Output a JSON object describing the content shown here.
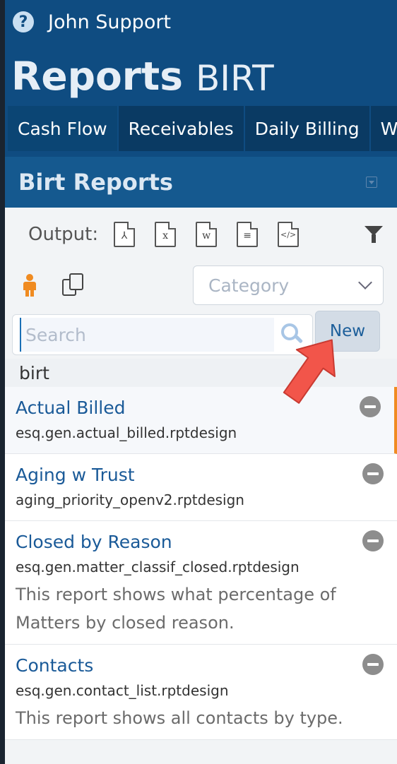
{
  "header": {
    "user_name": "John Support",
    "help_icon": "question-circle-icon"
  },
  "page": {
    "title": "Reports",
    "subtitle": "BIRT"
  },
  "tabs": [
    {
      "label": "Cash Flow",
      "active": true
    },
    {
      "label": "Receivables",
      "active": false
    },
    {
      "label": "Daily Billing",
      "active": false
    },
    {
      "label": "W",
      "active": false
    }
  ],
  "panel": {
    "title": "Birt Reports",
    "output_label": "Output:",
    "output_formats": [
      {
        "icon": "pdf-file-icon",
        "glyph": "⅄"
      },
      {
        "icon": "excel-file-icon",
        "glyph": "x"
      },
      {
        "icon": "word-file-icon",
        "glyph": "w"
      },
      {
        "icon": "text-file-icon",
        "glyph": "≡"
      },
      {
        "icon": "html-file-icon",
        "glyph": "</>"
      }
    ],
    "category_placeholder": "Category",
    "search_placeholder": "Search",
    "new_label": "New",
    "group_label": "birt"
  },
  "reports": [
    {
      "name": "Actual Billed",
      "file": "esq.gen.actual_billed.rptdesign",
      "description": "",
      "active": true
    },
    {
      "name": "Aging w Trust",
      "file": "aging_priority_openv2.rptdesign",
      "description": "",
      "active": false
    },
    {
      "name": "Closed by Reason",
      "file": "esq.gen.matter_classif_closed.rptdesign",
      "description": "This report shows what percentage of Matters by closed reason.",
      "active": false
    },
    {
      "name": "Contacts",
      "file": "esq.gen.contact_list.rptdesign",
      "description": "This report shows all contacts by type.",
      "active": false
    }
  ],
  "colors": {
    "brand_blue": "#0f4c81",
    "accent_orange": "#f08b21",
    "annotation_arrow": "#f2554a"
  }
}
